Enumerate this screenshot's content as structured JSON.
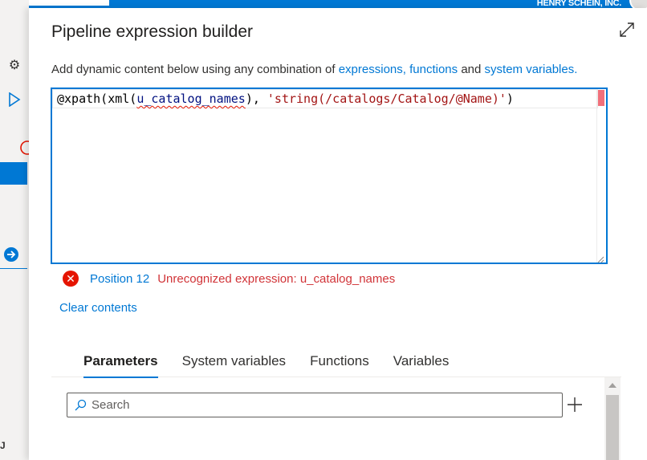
{
  "background": {
    "org_name": "HENRY SCHEIN, INC."
  },
  "panel": {
    "title": "Pipeline expression builder",
    "description": {
      "prefix": "Add dynamic content below using any combination of ",
      "link_expressions": "expressions,",
      "link_functions": "functions",
      "middle": " and ",
      "link_system_variables": "system variables."
    },
    "editor": {
      "tokens": {
        "t1": "@xpath(xml(",
        "t2": "u_catalog_names",
        "t3": "), ",
        "t4": "'string(/catalogs/Catalog/@Name)'",
        "t5": ")"
      }
    },
    "error": {
      "position": "Position 12",
      "message": "Unrecognized expression: u_catalog_names",
      "color": "#e51400"
    },
    "clear_label": "Clear contents",
    "tabs": [
      {
        "label": "Parameters",
        "active": true
      },
      {
        "label": "System variables",
        "active": false
      },
      {
        "label": "Functions",
        "active": false
      },
      {
        "label": "Variables",
        "active": false
      }
    ],
    "search": {
      "placeholder": "Search",
      "value": ""
    }
  },
  "colors": {
    "accent": "#0078d4",
    "error": "#d13438"
  }
}
